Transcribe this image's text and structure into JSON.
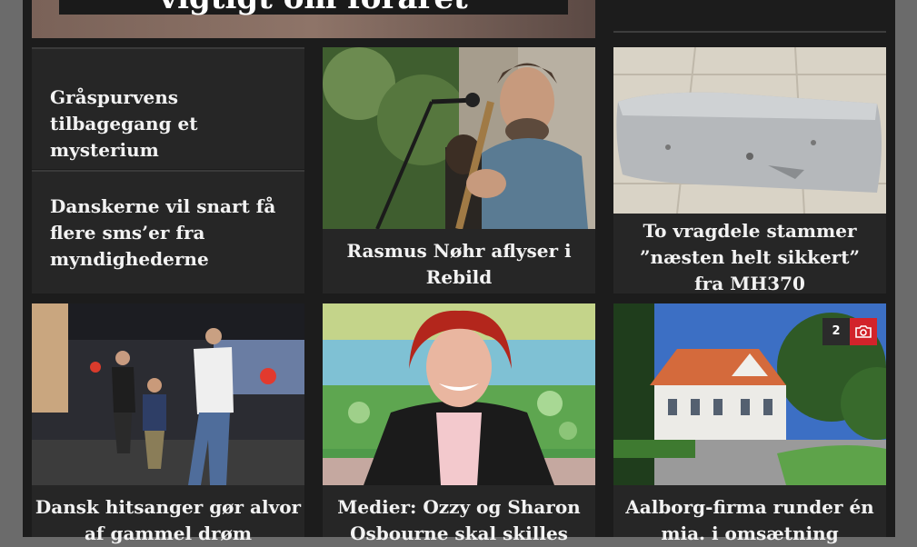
{
  "hero": {
    "headline": "vigtigt om foråret"
  },
  "articles": [
    {
      "title": "Gråspurvens tilbagegang et mysterium"
    },
    {
      "title": "Danskerne vil snart få flere sms’er fra myndighederne"
    },
    {
      "title": "Rasmus Nøhr aflyser i Rebild"
    },
    {
      "title": "To vragdele stammer ”næsten helt sikkert” fra MH370"
    },
    {
      "title": "Dansk hitsanger gør alvor af gammel drøm"
    },
    {
      "title": "Medier: Ozzy og Sharon Osbourne skal skilles"
    },
    {
      "title": "Aalborg-firma runder én mia. i omsætning"
    }
  ],
  "gallery_badge": {
    "count": "2",
    "icon": "camera-icon"
  },
  "colors": {
    "accent": "#d2232a",
    "card": "#262626",
    "page": "#1c1c1c"
  }
}
